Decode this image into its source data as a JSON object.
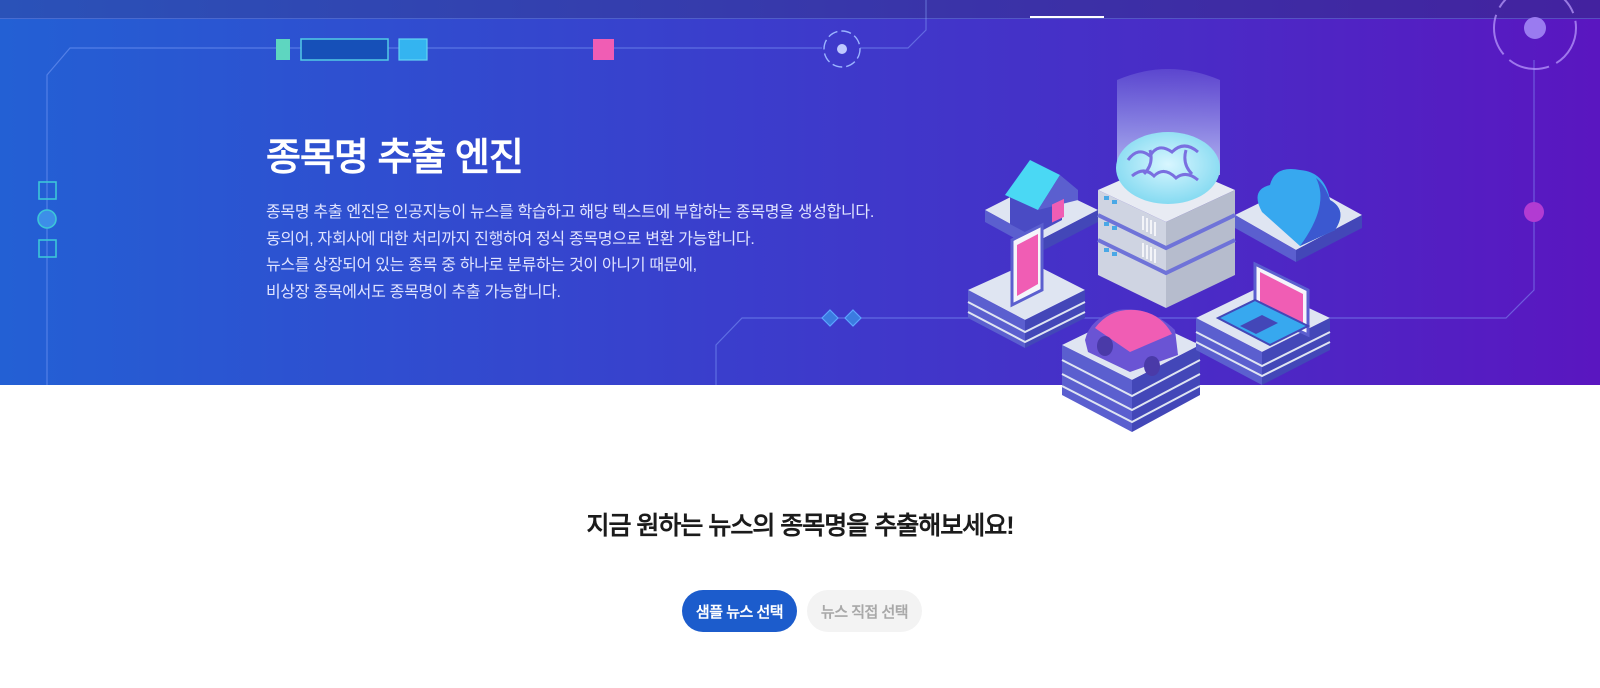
{
  "hero": {
    "title": "종목명 추출 엔진",
    "description": [
      "종목명 추출 엔진은 인공지능이 뉴스를 학습하고 해당 텍스트에 부합하는 종목명을 생성합니다.",
      "동의어, 자회사에 대한 처리까지 진행하여 정식 종목명으로 변환 가능합니다.",
      "뉴스를 상장되어 있는 종목 중 하나로 분류하는 것이 아니기 때문에,",
      "비상장 종목에서도 종목명이 추출 가능합니다."
    ]
  },
  "cta": {
    "title": "지금 원하는 뉴스의 종목명을 추출해보세요!",
    "sample_button": "샘플 뉴스 선택",
    "direct_button": "뉴스 직접 선택"
  },
  "colors": {
    "hero_start": "#2360d4",
    "hero_end": "#5a16c0",
    "primary_button": "#1c5ccc",
    "secondary_button": "#f3f3f3"
  }
}
